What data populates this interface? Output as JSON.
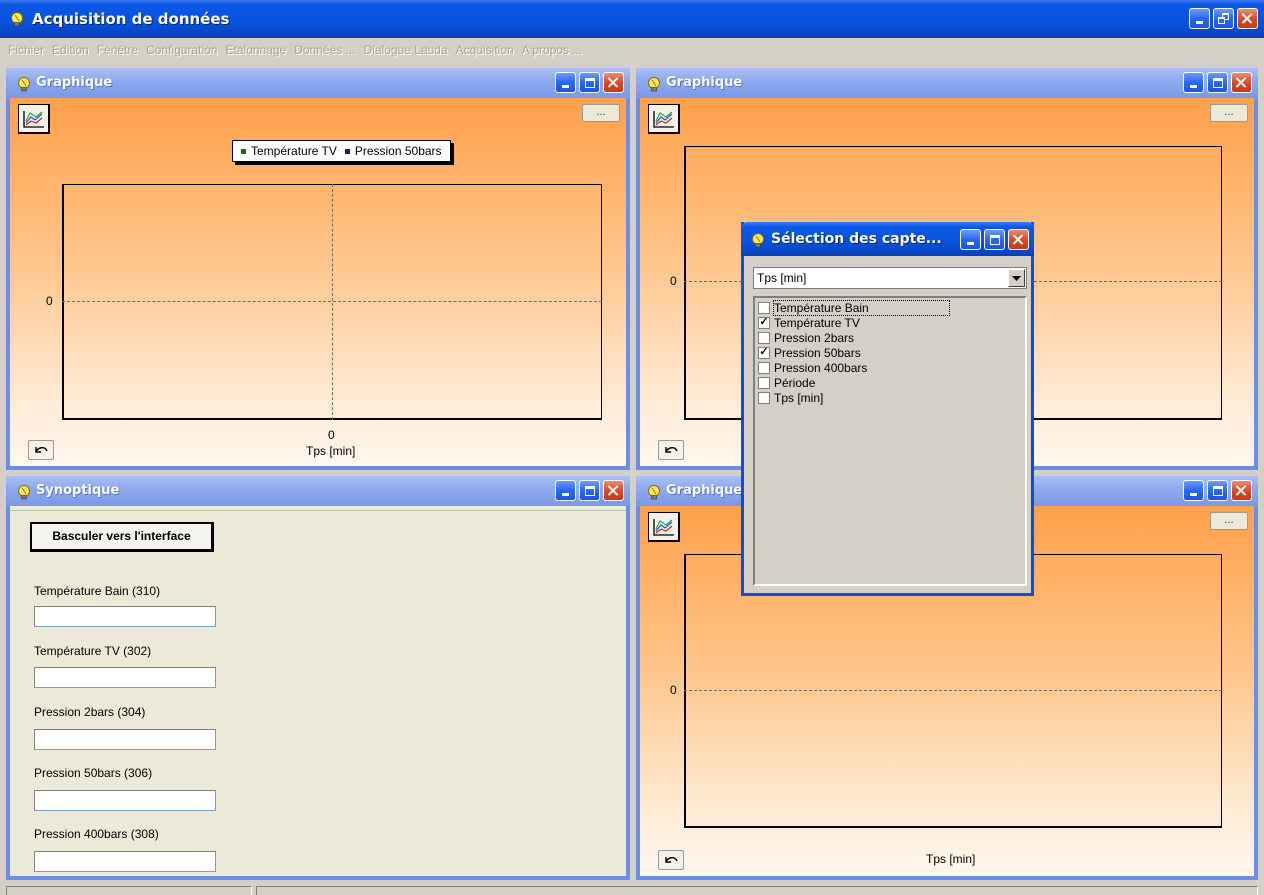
{
  "app": {
    "title": "Acquisition de données"
  },
  "menu": [
    "Fichier",
    "Edition",
    "Fenêtre",
    "Configuration",
    "Etalonnage",
    "Données ...",
    "Dialogue Lauda",
    "Acquisition",
    "A propos ..."
  ],
  "graph_tl": {
    "title": "Graphique",
    "dots_label": "...",
    "legend": [
      {
        "label": "Température TV",
        "color": "#1a6b1a"
      },
      {
        "label": "Pression 50bars",
        "color": "#1a1a8b"
      }
    ],
    "y_tick": "0",
    "x_tick": "0",
    "x_title": "Tps [min]"
  },
  "graph_tr": {
    "title": "Graphique",
    "dots_label": "...",
    "y_tick": "0"
  },
  "graph_br": {
    "title": "Graphique",
    "dots_label": "...",
    "y_tick": "0",
    "x_title": "Tps [min]"
  },
  "synoptique": {
    "title": "Synoptique",
    "switch_button": "Basculer vers l'interface",
    "fields": [
      {
        "label": "Température Bain (310)",
        "value": ""
      },
      {
        "label": "Température TV (302)",
        "value": ""
      },
      {
        "label": "Pression 2bars (304)",
        "value": ""
      },
      {
        "label": "Pression 50bars (306)",
        "value": ""
      },
      {
        "label": "Pression 400bars (308)",
        "value": ""
      }
    ]
  },
  "dialog": {
    "title": "Sélection des capte...",
    "x_axis_selected": "Tps [min]",
    "sensors": [
      {
        "label": "Température Bain",
        "checked": false
      },
      {
        "label": "Température TV",
        "checked": true
      },
      {
        "label": "Pression 2bars",
        "checked": false
      },
      {
        "label": "Pression 50bars",
        "checked": true
      },
      {
        "label": "Pression 400bars",
        "checked": false
      },
      {
        "label": "Période",
        "checked": false
      },
      {
        "label": "Tps [min]",
        "checked": false
      }
    ]
  },
  "chart_data": [
    {
      "type": "line",
      "title": "",
      "xlabel": "Tps [min]",
      "ylabel": "",
      "x_ticks": [
        "0"
      ],
      "y_ticks": [
        "0"
      ],
      "series": [
        {
          "name": "Température TV",
          "values": []
        },
        {
          "name": "Pression 50bars",
          "values": []
        }
      ],
      "legend": "top-center"
    },
    {
      "type": "line",
      "title": "",
      "xlabel": "",
      "ylabel": "",
      "y_ticks": [
        "0"
      ],
      "series": []
    },
    {
      "type": "line",
      "title": "",
      "xlabel": "Tps [min]",
      "ylabel": "",
      "y_ticks": [
        "0"
      ],
      "series": []
    }
  ]
}
